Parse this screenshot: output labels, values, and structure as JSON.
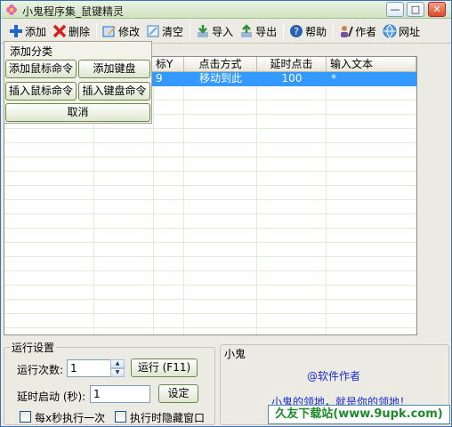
{
  "window": {
    "title": "小鬼程序集_鼠键精灵",
    "minimize_glyph": "—",
    "maximize_glyph": "□",
    "close_glyph": "✕"
  },
  "toolbar": {
    "items": [
      {
        "label": "添加",
        "icon": "plus-icon",
        "color": "#1e66c8"
      },
      {
        "label": "删除",
        "icon": "delete-x-icon",
        "color": "#d42121"
      },
      {
        "label": "修改",
        "icon": "edit-icon",
        "color": "#2c6bb3"
      },
      {
        "label": "清空",
        "icon": "clear-icon",
        "color": "#3a7fc4"
      },
      {
        "label": "导入",
        "icon": "import-icon",
        "color": "#2f8f3a"
      },
      {
        "label": "导出",
        "icon": "export-icon",
        "color": "#2f8f3a"
      },
      {
        "label": "帮助",
        "icon": "help-icon",
        "color": "#2b5fb0"
      },
      {
        "label": "作者",
        "icon": "author-icon",
        "color": "#7a4fa0"
      },
      {
        "label": "网址",
        "icon": "globe-icon",
        "color": "#1f6fc2"
      }
    ]
  },
  "table": {
    "headers": [
      "标Y",
      "点击方式",
      "延时点击",
      "输入文本"
    ],
    "rows": [
      {
        "y": "9",
        "click_mode": "移动到此",
        "delay": "100",
        "text": "*"
      }
    ],
    "selection_color": "#3399ff"
  },
  "popup": {
    "title": "添加分类",
    "buttons": [
      "添加鼠标命令",
      "添加键盘",
      "插入鼠标命令",
      "插入键盘命令",
      "取消"
    ]
  },
  "settings": {
    "legend": "运行设置",
    "run_count_label": "运行次数:",
    "run_count_value": "1",
    "run_button": "运行 (F11)",
    "delay_start_label": "延时启动 (秒):",
    "delay_start_value": "1",
    "set_button": "设定",
    "every_x_seconds_label": "每x秒执行一次",
    "hide_window_label": "执行时隐藏窗口"
  },
  "note": {
    "title": "小鬼",
    "line1": "@软件作者",
    "line2": "小鬼的领地，就是你的领地！"
  },
  "watermark": "久友下载站(www.9upk.com)"
}
